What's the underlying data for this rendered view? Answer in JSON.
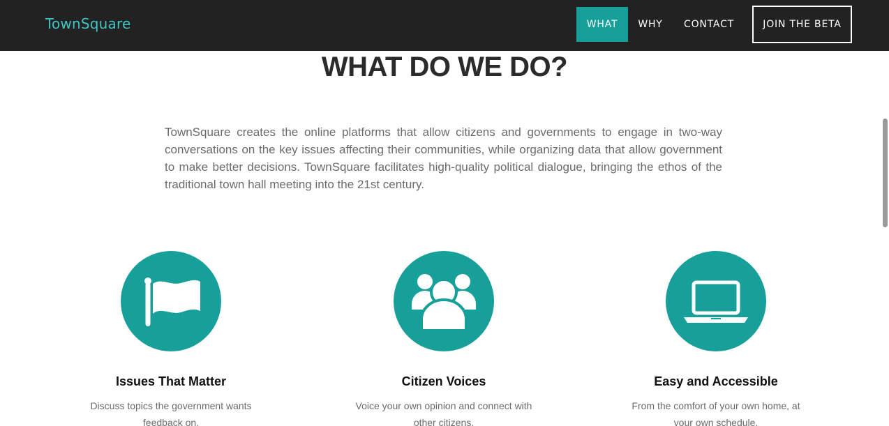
{
  "nav": {
    "brand": "TownSquare",
    "items": [
      {
        "label": "WHAT",
        "active": true
      },
      {
        "label": "WHY",
        "active": false
      },
      {
        "label": "CONTACT",
        "active": false
      }
    ],
    "cta_label": "JOIN THE BETA"
  },
  "section": {
    "headline": "WHAT DO WE DO?",
    "intro": "TownSquare creates the online platforms that allow citizens and governments to engage in two-way conversations on the key issues affecting their communities, while organizing data that allow government to make better decisions. TownSquare facilitates high-quality political dialogue, bringing the ethos of the traditional town hall meeting into the 21st century."
  },
  "features": [
    {
      "icon": "flag-icon",
      "title": "Issues That Matter",
      "description": "Discuss topics the government wants feedback on."
    },
    {
      "icon": "users-icon",
      "title": "Citizen Voices",
      "description": "Voice your own opinion and connect with other citizens."
    },
    {
      "icon": "laptop-icon",
      "title": "Easy and Accessible",
      "description": "From the comfort of your own home, at your own schedule."
    }
  ],
  "colors": {
    "navbar_bg": "#222222",
    "accent": "#17a09a",
    "brand_text": "#3fc5c2"
  }
}
